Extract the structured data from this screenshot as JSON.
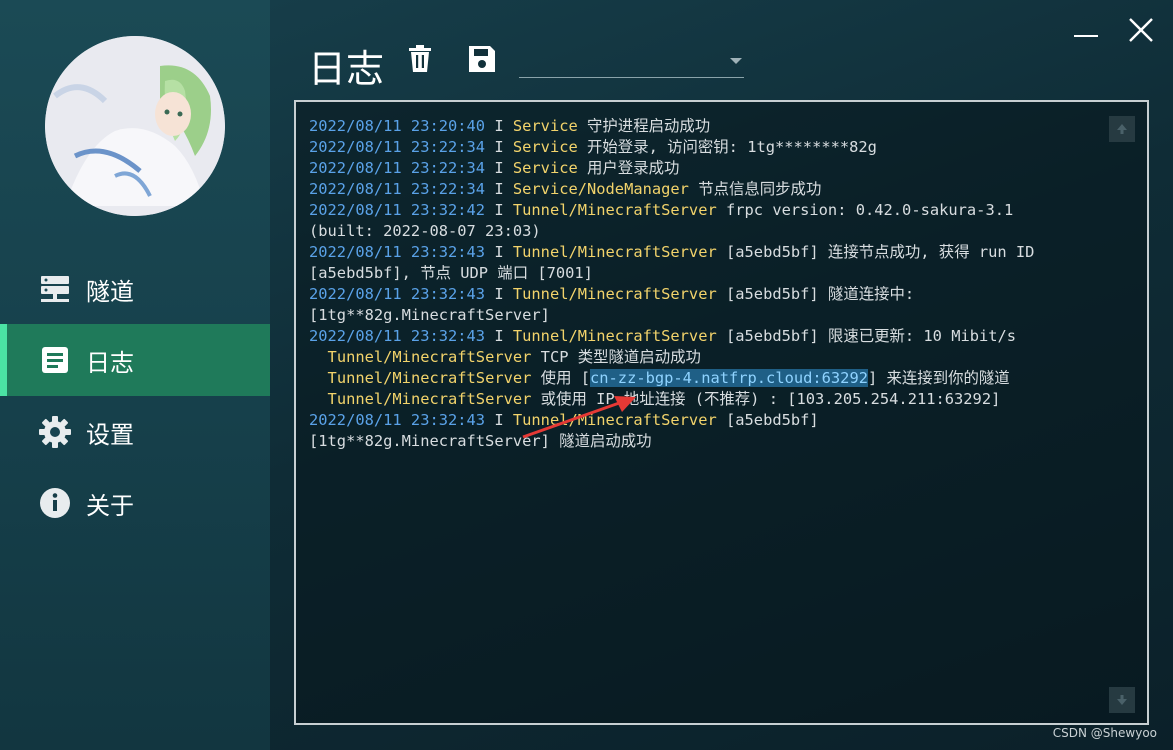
{
  "sidebar": {
    "items": [
      {
        "label": "隧道",
        "icon": "server-icon"
      },
      {
        "label": "日志",
        "icon": "document-icon",
        "active": true
      },
      {
        "label": "设置",
        "icon": "gear-icon"
      },
      {
        "label": "关于",
        "icon": "info-icon"
      }
    ]
  },
  "header": {
    "title": "日志",
    "dropdown_value": ""
  },
  "log": {
    "lines": [
      {
        "ts": "2022/08/11 23:20:40",
        "level": "I",
        "src": "Service",
        "msg": "守护进程启动成功"
      },
      {
        "ts": "2022/08/11 23:22:34",
        "level": "I",
        "src": "Service",
        "msg": "开始登录, 访问密钥: 1tg********82g"
      },
      {
        "ts": "2022/08/11 23:22:34",
        "level": "I",
        "src": "Service",
        "msg": "用户登录成功"
      },
      {
        "ts": "2022/08/11 23:22:34",
        "level": "I",
        "src": "Service/NodeManager",
        "msg": "节点信息同步成功"
      },
      {
        "ts": "2022/08/11 23:32:42",
        "level": "I",
        "src": "Tunnel/MinecraftServer",
        "msg": "frpc version: 0.42.0-sakura-3.1"
      },
      {
        "cont": "(built: 2022-08-07 23:03)"
      },
      {
        "ts": "2022/08/11 23:32:43",
        "level": "I",
        "src": "Tunnel/MinecraftServer",
        "msg": "[a5ebd5bf] 连接节点成功, 获得 run ID"
      },
      {
        "cont": "[a5ebd5bf], 节点 UDP 端口 [7001]"
      },
      {
        "ts": "2022/08/11 23:32:43",
        "level": "I",
        "src": "Tunnel/MinecraftServer",
        "msg": "[a5ebd5bf] 隧道连接中:"
      },
      {
        "cont": "[1tg**82g.MinecraftServer]"
      },
      {
        "ts": "2022/08/11 23:32:43",
        "level": "I",
        "src": "Tunnel/MinecraftServer",
        "msg": "[a5ebd5bf] 限速已更新: 10 Mibit/s"
      }
    ],
    "tcp_line": {
      "src": "Tunnel/MinecraftServer",
      "msg": "TCP 类型隧道启动成功"
    },
    "use_line": {
      "src": "Tunnel/MinecraftServer",
      "pre": "使用 [",
      "addr": "cn-zz-bgp-4.natfrp.cloud:63292",
      "post": "] 来连接到你的隧道"
    },
    "ip_line": {
      "src": "Tunnel/MinecraftServer",
      "msg": "或使用 IP 地址连接 (不推荐) : [103.205.254.211:63292]"
    },
    "final_line": {
      "ts": "2022/08/11 23:32:43",
      "level": "I",
      "src": "Tunnel/MinecraftServer",
      "msg": "[a5ebd5bf]"
    },
    "final_cont": "[1tg**82g.MinecraftServer] 隧道启动成功"
  },
  "watermark": "CSDN @Shewyoo",
  "colors": {
    "accent": "#1f7a5a",
    "active_bar": "#4be3a4",
    "timestamp": "#5aa2e8",
    "source": "#f2d36b"
  }
}
